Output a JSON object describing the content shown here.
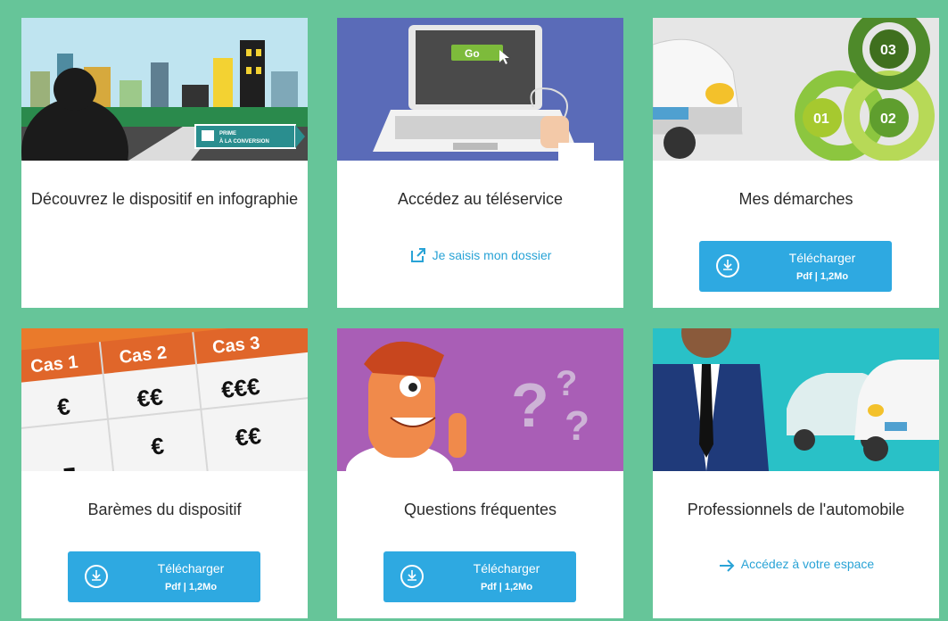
{
  "cards": [
    {
      "title": "Découvrez le dispositif en infographie",
      "sign_line1": "PRIME",
      "sign_line2": "À LA CONVERSION"
    },
    {
      "title": "Accédez au téléservice",
      "go_label": "Go",
      "link_label": "Je saisis mon dossier"
    },
    {
      "title": "Mes démarches",
      "badges": [
        "03",
        "01",
        "02"
      ],
      "download": {
        "label": "Télécharger",
        "meta": "Pdf | 1,2Mo"
      }
    },
    {
      "title": "Barèmes du dispositif",
      "table_headers": [
        "Cas 1",
        "Cas 2",
        "Cas 3"
      ],
      "table_cells": [
        "€",
        "€€",
        "€€€",
        "€",
        "€€"
      ],
      "download": {
        "label": "Télécharger",
        "meta": "Pdf | 1,2Mo"
      }
    },
    {
      "title": "Questions fréquentes",
      "download": {
        "label": "Télécharger",
        "meta": "Pdf | 1,2Mo"
      }
    },
    {
      "title": "Professionnels de l'automobile",
      "link_label": "Accédez à votre espace"
    }
  ],
  "colors": {
    "background": "#66c599",
    "button": "#2ea9e1",
    "link": "#29a3d6",
    "card": "#ffffff"
  },
  "icons": [
    "download-icon",
    "external-link-icon",
    "arrow-right-icon"
  ]
}
